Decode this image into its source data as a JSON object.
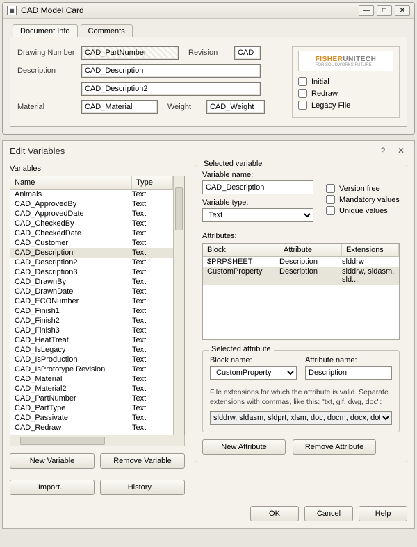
{
  "card": {
    "title": "CAD Model Card",
    "min_icon": "—",
    "max_icon": "□",
    "close_icon": "✕",
    "tabs": {
      "doc": "Document Info",
      "comments": "Comments"
    },
    "labels": {
      "drawing_number": "Drawing Number",
      "revision": "Revision",
      "description": "Description",
      "material": "Material",
      "weight": "Weight"
    },
    "fields": {
      "drawing_number": "CAD_PartNumber",
      "revision": "CAD",
      "desc1": "CAD_Description",
      "desc2": "CAD_Description2",
      "material": "CAD_Material",
      "weight": "CAD_Weight"
    },
    "logo": {
      "word1": "FISHER",
      "word2": "UNITECH",
      "tag": "FOR SOLIDWORKS FUTURE"
    },
    "checks": {
      "initial": "Initial",
      "redraw": "Redraw",
      "legacy": "Legacy File"
    }
  },
  "dlg": {
    "title": "Edit Variables",
    "help_icon": "?",
    "close_icon": "✕",
    "variables_label": "Variables:",
    "col_name": "Name",
    "col_type": "Type",
    "variables": [
      {
        "name": "Animals",
        "type": "Text"
      },
      {
        "name": "CAD_ApprovedBy",
        "type": "Text"
      },
      {
        "name": "CAD_ApprovedDate",
        "type": "Text"
      },
      {
        "name": "CAD_CheckedBy",
        "type": "Text"
      },
      {
        "name": "CAD_CheckedDate",
        "type": "Text"
      },
      {
        "name": "CAD_Customer",
        "type": "Text"
      },
      {
        "name": "CAD_Description",
        "type": "Text"
      },
      {
        "name": "CAD_Description2",
        "type": "Text"
      },
      {
        "name": "CAD_Description3",
        "type": "Text"
      },
      {
        "name": "CAD_DrawnBy",
        "type": "Text"
      },
      {
        "name": "CAD_DrawnDate",
        "type": "Text"
      },
      {
        "name": "CAD_ECONumber",
        "type": "Text"
      },
      {
        "name": "CAD_Finish1",
        "type": "Text"
      },
      {
        "name": "CAD_Finish2",
        "type": "Text"
      },
      {
        "name": "CAD_Finish3",
        "type": "Text"
      },
      {
        "name": "CAD_HeatTreat",
        "type": "Text"
      },
      {
        "name": "CAD_IsLegacy",
        "type": "Text"
      },
      {
        "name": "CAD_IsProduction",
        "type": "Text"
      },
      {
        "name": "CAD_IsPrototype Revision",
        "type": "Text"
      },
      {
        "name": "CAD_Material",
        "type": "Text"
      },
      {
        "name": "CAD_Material2",
        "type": "Text"
      },
      {
        "name": "CAD_PartNumber",
        "type": "Text"
      },
      {
        "name": "CAD_PartType",
        "type": "Text"
      },
      {
        "name": "CAD_Passivate",
        "type": "Text"
      },
      {
        "name": "CAD_Redraw",
        "type": "Text"
      }
    ],
    "selected_variable_index": 6,
    "btn_new_var": "New Variable",
    "btn_remove_var": "Remove Variable",
    "btn_import": "Import...",
    "btn_history": "History...",
    "selvar": {
      "legend": "Selected variable",
      "name_label": "Variable name:",
      "name_value": "CAD_Description",
      "type_label": "Variable type:",
      "type_value": "Text",
      "chk_version": "Version free",
      "chk_mandatory": "Mandatory values",
      "chk_unique": "Unique values"
    },
    "attrs": {
      "label": "Attributes:",
      "col_block": "Block",
      "col_attr": "Attribute",
      "col_ext": "Extensions",
      "rows": [
        {
          "block": "$PRPSHEET",
          "attr": "Description",
          "ext": "slddrw"
        },
        {
          "block": "CustomProperty",
          "attr": "Description",
          "ext": "slddrw, sldasm, sld..."
        }
      ],
      "selected_index": 1
    },
    "selattr": {
      "legend": "Selected attribute",
      "block_label": "Block name:",
      "block_value": "CustomProperty",
      "attrname_label": "Attribute name:",
      "attrname_value": "Description",
      "ext_note": "File extensions for which the attribute is valid. Separate extensions with commas, like this: \"txt, gif, dwg, doc\":",
      "ext_value": "slddrw, sldasm, sldprt, xlsm, doc, docm, docx, dot, mpp, mppx, p",
      "btn_new": "New Attribute",
      "btn_remove": "Remove Attribute"
    },
    "footer": {
      "ok": "OK",
      "cancel": "Cancel",
      "help": "Help"
    }
  }
}
